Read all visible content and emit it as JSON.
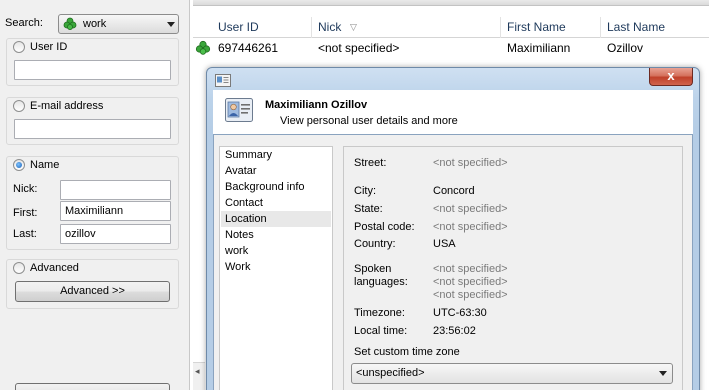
{
  "search": {
    "label": "Search:",
    "group_value": "work",
    "options": {
      "user_id": {
        "label": "User ID",
        "value": ""
      },
      "email": {
        "label": "E-mail address",
        "value": ""
      },
      "name": {
        "label": "Name",
        "nick_label": "Nick:",
        "nick_value": "",
        "first_label": "First:",
        "first_value": "Maximiliann",
        "last_label": "Last:",
        "last_value": "ozillov"
      },
      "advanced": {
        "label": "Advanced",
        "button": "Advanced >>"
      }
    }
  },
  "grid": {
    "columns": [
      "User ID",
      "Nick",
      "First Name",
      "Last Name"
    ],
    "rows": [
      {
        "user_id": "697446261",
        "nick": "<not specified>",
        "first": "Maximiliann",
        "last": "Ozillov"
      }
    ]
  },
  "dialog": {
    "close_label": "x",
    "name": "Maximiliann Ozillov",
    "subtitle": "View personal user details and more",
    "nav": [
      "Summary",
      "Avatar",
      "Background info",
      "Contact",
      "Location",
      "Notes",
      "work",
      "Work"
    ],
    "selected_nav": "Location",
    "details": {
      "street_label": "Street:",
      "street": "<not specified>",
      "city_label": "City:",
      "city": "Concord",
      "state_label": "State:",
      "state": "<not specified>",
      "postal_label": "Postal code:",
      "postal": "<not specified>",
      "country_label": "Country:",
      "country": "USA",
      "languages_label": "Spoken languages:",
      "languages": [
        "<not specified>",
        "<not specified>",
        "<not specified>"
      ],
      "timezone_label": "Timezone:",
      "timezone": "UTC-63:30",
      "localtime_label": "Local time:",
      "localtime": "23:56:02",
      "custom_tz_label": "Set custom time zone",
      "custom_tz_value": "<unspecified>"
    }
  },
  "colors": {
    "accent": "#1a5fb4",
    "muted": "#7a7a7a",
    "close": "#c0402a"
  }
}
